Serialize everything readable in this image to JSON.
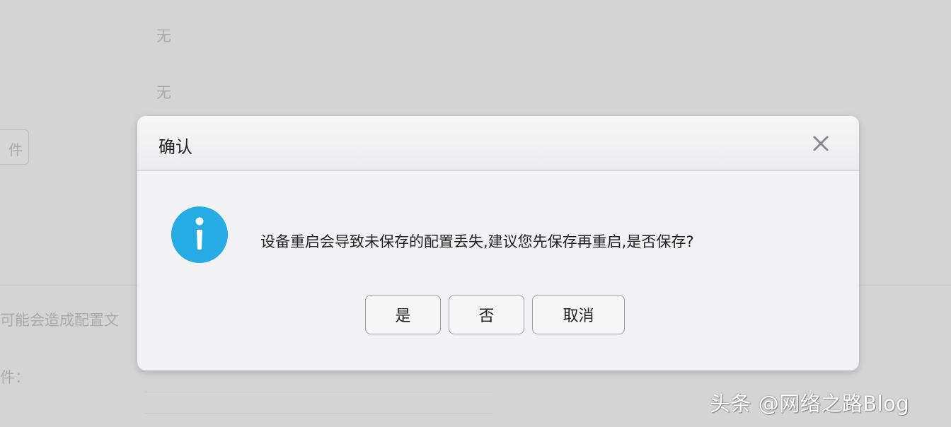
{
  "background": {
    "value_1": "无",
    "value_2": "无",
    "button_partial": "件",
    "warning_partial": "可能会造成配置文",
    "field_label_partial": "件："
  },
  "dialog": {
    "title": "确认",
    "message": "设备重启会导致未保存的配置丢失,建议您先保存再重启,是否保存?",
    "buttons": {
      "yes": "是",
      "no": "否",
      "cancel": "取消"
    },
    "icons": {
      "close": "close-icon",
      "info": "info-icon"
    },
    "colors": {
      "info_icon": "#27abe5"
    }
  },
  "watermark": "头条 @网络之路Blog"
}
